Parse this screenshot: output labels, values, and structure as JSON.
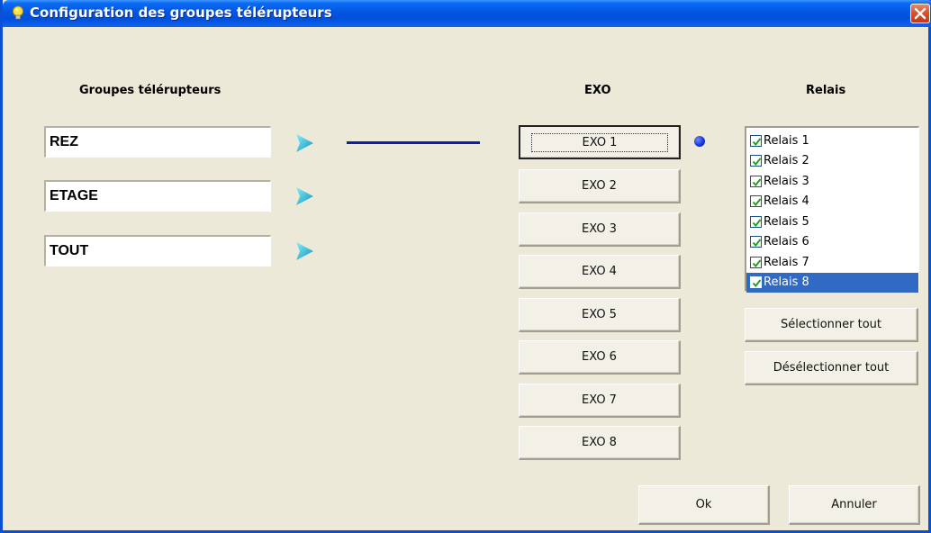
{
  "window": {
    "title": "Configuration des groupes télérupteurs"
  },
  "headers": {
    "groups": "Groupes télérupteurs",
    "exo": "EXO",
    "relais": "Relais"
  },
  "groups": [
    {
      "value": "REZ"
    },
    {
      "value": "ETAGE"
    },
    {
      "value": "TOUT"
    }
  ],
  "exo_buttons": [
    "EXO 1",
    "EXO 2",
    "EXO 3",
    "EXO 4",
    "EXO 5",
    "EXO 6",
    "EXO 7",
    "EXO 8"
  ],
  "relais": [
    {
      "label": "Relais 1",
      "checked": true
    },
    {
      "label": "Relais 2",
      "checked": true
    },
    {
      "label": "Relais 3",
      "checked": true
    },
    {
      "label": "Relais 4",
      "checked": true
    },
    {
      "label": "Relais 5",
      "checked": true
    },
    {
      "label": "Relais 6",
      "checked": true
    },
    {
      "label": "Relais 7",
      "checked": true
    },
    {
      "label": "Relais 8",
      "checked": true,
      "selected": true
    }
  ],
  "actions": {
    "select_all": "Sélectionner tout",
    "deselect_all": "Désélectionner tout",
    "ok": "Ok",
    "cancel": "Annuler"
  },
  "colors": {
    "titlebar": "#0050DA",
    "selection": "#316AC5",
    "link_line": "#0A1EAE",
    "arrow": "#1FB6D4"
  }
}
